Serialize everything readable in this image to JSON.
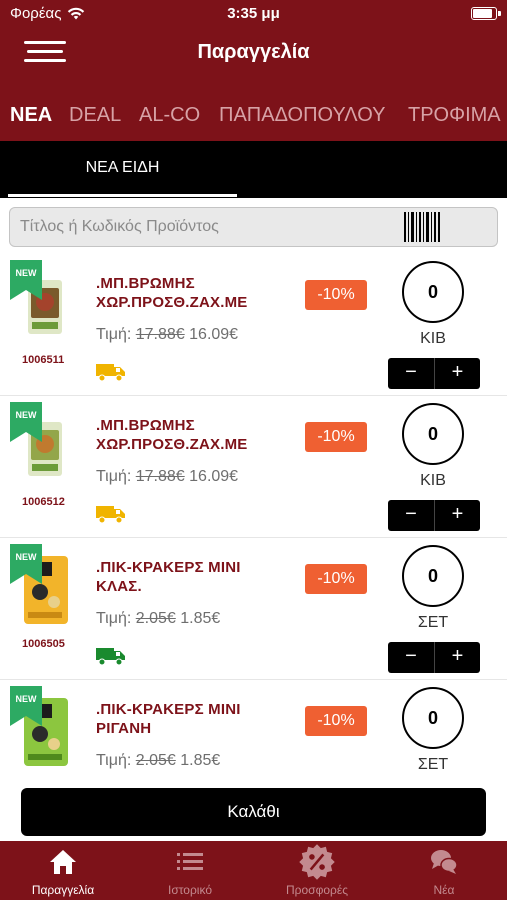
{
  "status": {
    "carrier": "Φορέας",
    "time": "3:35 μμ"
  },
  "header": {
    "title": "Παραγγελία"
  },
  "categories": [
    {
      "label": "ΝΕΑ",
      "active": true
    },
    {
      "label": "DEAL",
      "active": false
    },
    {
      "label": "AL-CO",
      "active": false
    },
    {
      "label": "ΠΑΠΑΔΟΠΟΥΛΟΥ",
      "active": false
    },
    {
      "label": "ΤΡΟΦΙΜΑ",
      "active": false
    }
  ],
  "subtab": {
    "label": "ΝΕΑ ΕΙΔΗ"
  },
  "search": {
    "placeholder": "Τίτλος ή Κωδικός Προϊόντος"
  },
  "price_label": "Τιμή:",
  "badge_label": "NEW",
  "colors": {
    "brand": "#7d1219",
    "discount": "#ef6032",
    "truck_yellow": "#f0b400",
    "truck_green": "#1a8a2e"
  },
  "products": [
    {
      "code": "1006511",
      "name_line1": ".ΜΠ.ΒΡΩΜΗΣ",
      "name_line2": "ΧΩΡ.ΠΡΟΣΘ.ΖΑΧ.ΜΕ",
      "old_price": "17.88€",
      "price": "16.09€",
      "discount": "-10%",
      "qty": "0",
      "unit": "ΚΙΒ",
      "truck": "truck-yellow-icon"
    },
    {
      "code": "1006512",
      "name_line1": ".ΜΠ.ΒΡΩΜΗΣ",
      "name_line2": "ΧΩΡ.ΠΡΟΣΘ.ΖΑΧ.ΜΕ",
      "old_price": "17.88€",
      "price": "16.09€",
      "discount": "-10%",
      "qty": "0",
      "unit": "ΚΙΒ",
      "truck": "truck-yellow-icon"
    },
    {
      "code": "1006505",
      "name_line1": ".ΠΙΚ-ΚΡΑΚΕΡΣ ΜΙΝΙ",
      "name_line2": "ΚΛΑΣ.",
      "old_price": "2.05€",
      "price": "1.85€",
      "discount": "-10%",
      "qty": "0",
      "unit": "ΣΕΤ",
      "truck": "truck-green-icon"
    },
    {
      "code": "",
      "name_line1": ".ΠΙΚ-ΚΡΑΚΕΡΣ ΜΙΝΙ",
      "name_line2": "ΡΙΓΑΝΗ",
      "old_price": "2.05€",
      "price": "1.85€",
      "discount": "-10%",
      "qty": "0",
      "unit": "ΣΕΤ",
      "truck": ""
    }
  ],
  "stepper": {
    "minus": "−",
    "plus": "+"
  },
  "cart": {
    "label": "Καλάθι"
  },
  "tabbar": [
    {
      "label": "Παραγγελία",
      "icon": "home-icon",
      "active": true
    },
    {
      "label": "Ιστορικό",
      "icon": "list-icon",
      "active": false
    },
    {
      "label": "Προσφορές",
      "icon": "percent-badge-icon",
      "active": false
    },
    {
      "label": "Νέα",
      "icon": "chat-bubbles-icon",
      "active": false
    }
  ]
}
